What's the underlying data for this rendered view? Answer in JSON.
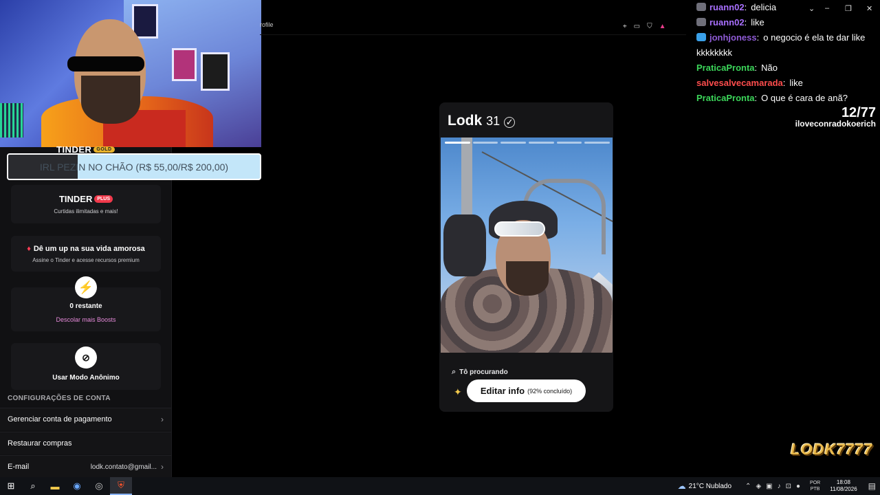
{
  "browser": {
    "address_fragment": "rofile"
  },
  "sidebar": {
    "gold_label": "TINDER",
    "gold_badge": "GOLD",
    "goal_bar": {
      "text": "IRL PEZIN NO CHÃO (R$ 55,00/R$ 200,00)",
      "progress": 0.275
    },
    "plus_card": {
      "title": "TINDER",
      "badge": "PLUS",
      "subtitle": "Curtidas ilimitadas e mais!"
    },
    "love_card": {
      "title": "Dê um up na sua vida amorosa",
      "subtitle": "Assine o Tinder e acesse recursos premium"
    },
    "boost_card": {
      "title": "0 restante",
      "link": "Descolar mais Boosts"
    },
    "anon_card": {
      "title": "Usar Modo Anônimo"
    },
    "section_heading": "CONFIGURAÇÕES DE CONTA",
    "rows": [
      {
        "label": "Gerenciar conta de pagamento"
      },
      {
        "label": "Restaurar compras"
      },
      {
        "label": "E-mail",
        "value": "lodk.contato@gmail..."
      }
    ]
  },
  "profile": {
    "name": "Lodk",
    "age": "31",
    "photo_count": 6,
    "active_photo": 1,
    "searching_label": "Tô procurando",
    "edit_button": "Editar info",
    "edit_percent": "(92% concluído)"
  },
  "chat": [
    {
      "user": "ruann02",
      "message": "delicia",
      "color": "#a970ff",
      "badge": "#6f6f7a"
    },
    {
      "user": "ruann02",
      "message": "like",
      "color": "#a970ff",
      "badge": "#6f6f7a"
    },
    {
      "user": "jonhjoness",
      "message": "o negocio é ela te dar like kkkkkkkk",
      "color": "#8f5bd6",
      "badge": "#3aa0e8"
    },
    {
      "user": "PraticaPronta",
      "message": "Não",
      "color": "#3cd65a"
    },
    {
      "user": "salvesalvecamarada",
      "message": "like",
      "color": "#ff4d4d"
    },
    {
      "user": "PraticaPronta",
      "message": "O que é cara de anã?",
      "color": "#3cd65a"
    }
  ],
  "counter": {
    "value": "12/77",
    "handle": "iloveconradokoerich"
  },
  "logo": {
    "text": "LODK7777"
  },
  "taskbar": {
    "weather": "21°C  Nublado",
    "lang_line1": "POR",
    "lang_line2": "PTB",
    "time": "18:08",
    "date": "11/08/2026"
  },
  "colors": {
    "accent_pink": "#e58ad9",
    "tinder_red": "#f0394b",
    "gold": "#e9b32a"
  }
}
